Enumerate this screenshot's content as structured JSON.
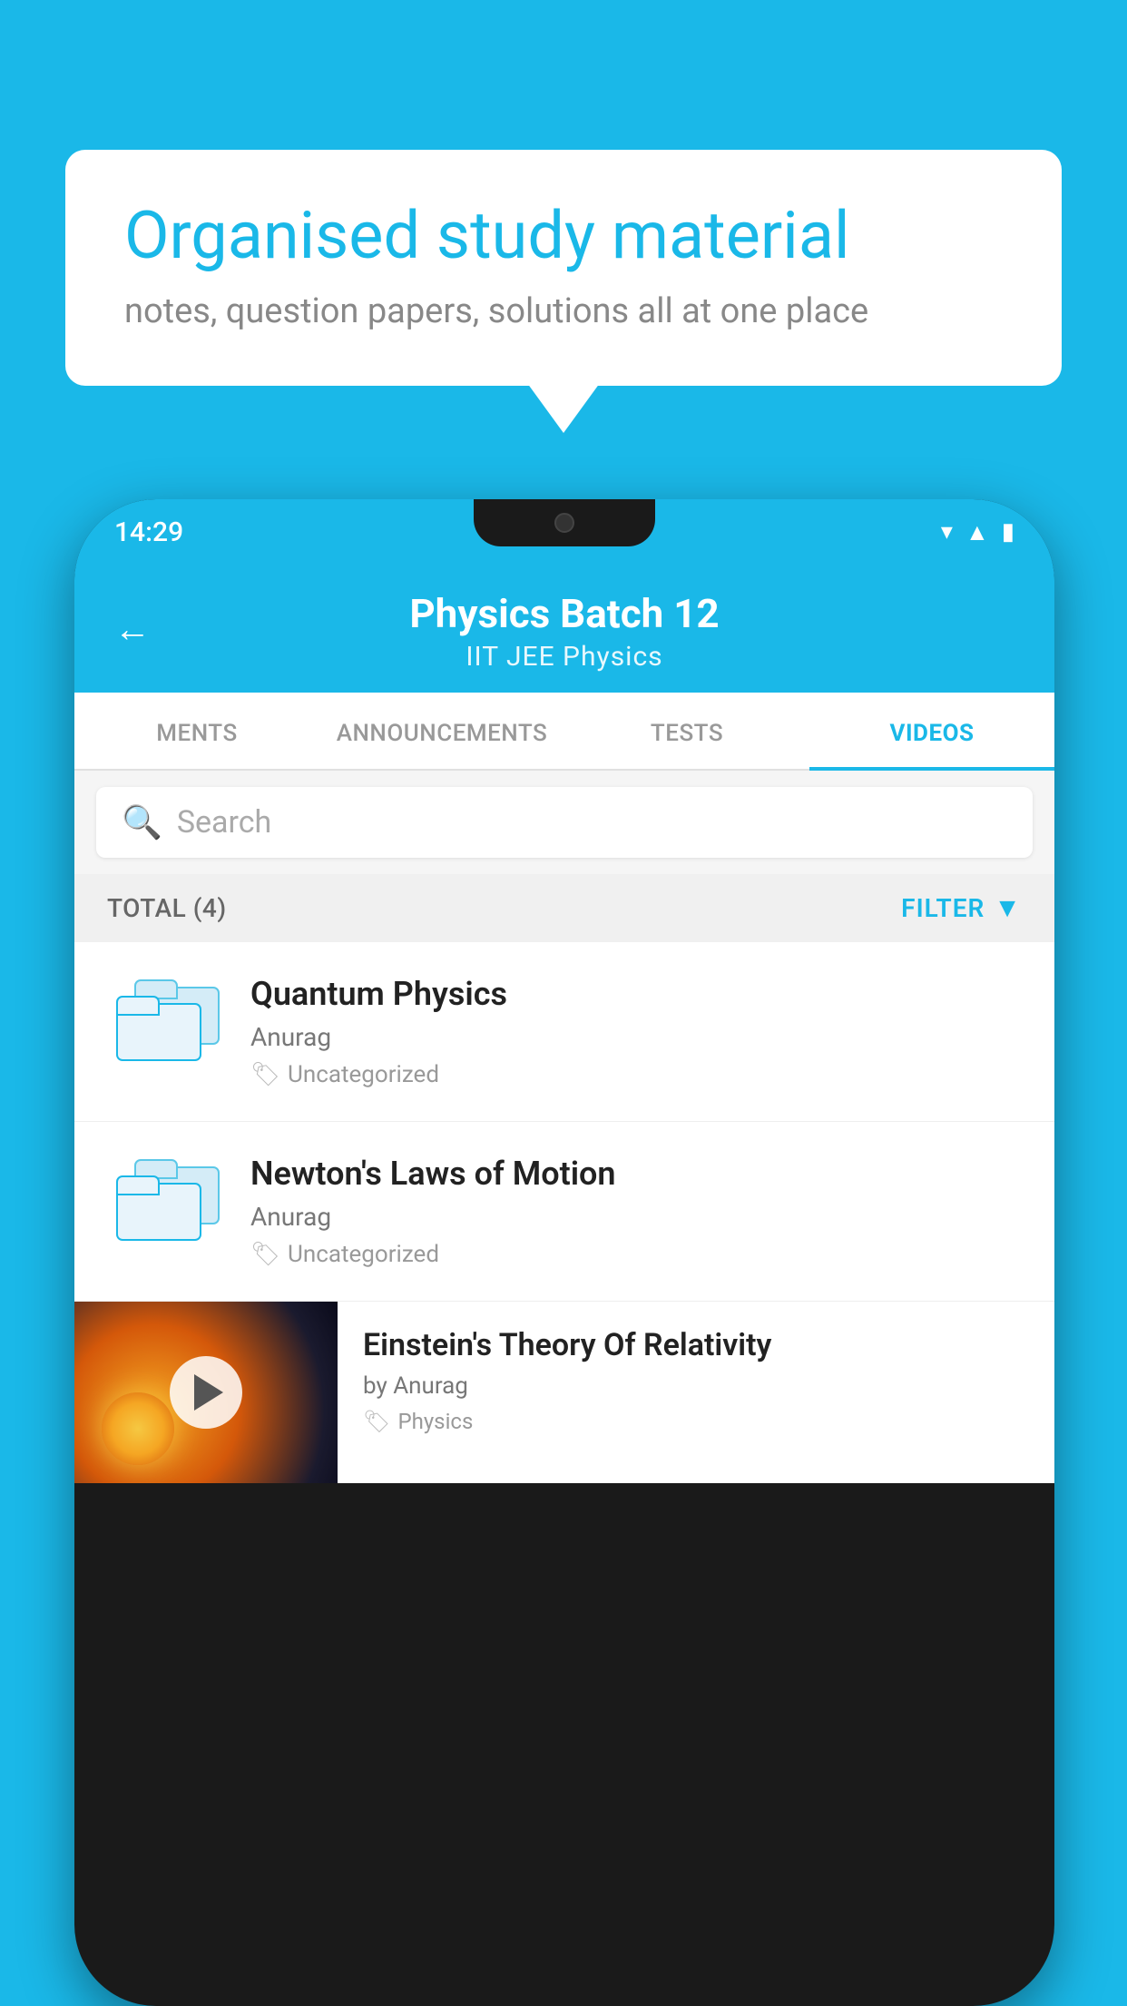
{
  "background_color": "#1ab8e8",
  "speech_bubble": {
    "title": "Organised study material",
    "subtitle": "notes, question papers, solutions all at one place"
  },
  "phone": {
    "status_bar": {
      "time": "14:29",
      "icons": [
        "wifi",
        "signal",
        "battery"
      ]
    },
    "header": {
      "back_label": "←",
      "title": "Physics Batch 12",
      "subtitle": "IIT JEE   Physics"
    },
    "tabs": [
      {
        "label": "MENTS",
        "active": false
      },
      {
        "label": "ANNOUNCEMENTS",
        "active": false
      },
      {
        "label": "TESTS",
        "active": false
      },
      {
        "label": "VIDEOS",
        "active": true
      }
    ],
    "search": {
      "placeholder": "Search"
    },
    "filter_bar": {
      "total_label": "TOTAL (4)",
      "filter_label": "FILTER"
    },
    "videos": [
      {
        "title": "Quantum Physics",
        "author": "Anurag",
        "tag": "Uncategorized",
        "type": "folder"
      },
      {
        "title": "Newton's Laws of Motion",
        "author": "Anurag",
        "tag": "Uncategorized",
        "type": "folder"
      },
      {
        "title": "Einstein's Theory Of Relativity",
        "author": "by Anurag",
        "tag": "Physics",
        "type": "video"
      }
    ]
  }
}
